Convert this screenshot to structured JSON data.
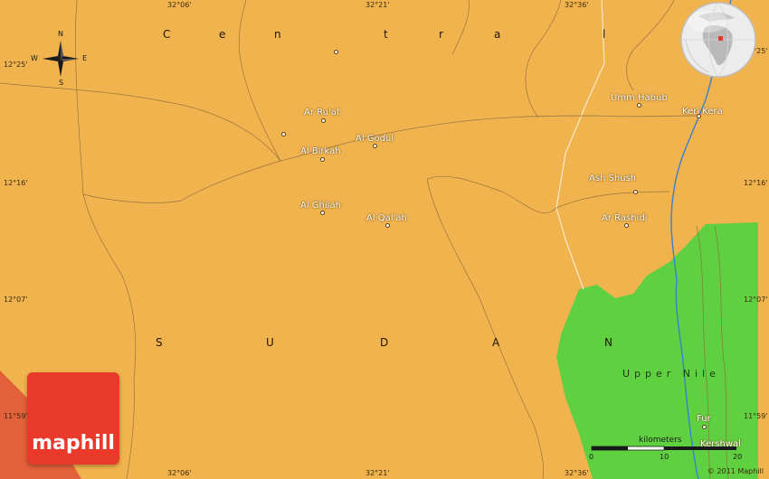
{
  "map": {
    "regions": {
      "central": [
        "C",
        "e",
        "n",
        "t",
        "r",
        "a",
        "l"
      ],
      "sudan": [
        "S",
        "U",
        "D",
        "A",
        "N"
      ],
      "upper_nile": "Upper Nile"
    },
    "places": [
      {
        "name": "Ar Ru'at",
        "id": "ar-ruat"
      },
      {
        "name": "Al Godul",
        "id": "al-godul"
      },
      {
        "name": "Al Birkah",
        "id": "al-birkah"
      },
      {
        "name": "Al Ghilah",
        "id": "al-ghilah"
      },
      {
        "name": "Al Qal'ah",
        "id": "al-qalah"
      },
      {
        "name": "Umm Habub",
        "id": "umm-habub"
      },
      {
        "name": "Keri Kera",
        "id": "keri-kera"
      },
      {
        "name": "Ash Shush",
        "id": "ash-shush"
      },
      {
        "name": "Ar Rashidi",
        "id": "ar-rashidi"
      },
      {
        "name": "Fur",
        "id": "fur"
      },
      {
        "name": "Kershwal",
        "id": "kershwal"
      }
    ],
    "coords": {
      "top": [
        "32°06'",
        "32°21'",
        "32°36'"
      ],
      "bottom": [
        "32°06'",
        "32°21'",
        "32°36'"
      ],
      "left": [
        "12°25'",
        "12°16'",
        "12°07'",
        "11°59'"
      ],
      "right": [
        "12°25'",
        "12°16'",
        "12°07'",
        "11°59'"
      ]
    },
    "compass": {
      "n": "N",
      "s": "S",
      "e": "E",
      "w": "W"
    },
    "scale": {
      "title": "kilometers",
      "ticks": [
        "0",
        "10",
        "20"
      ]
    },
    "logo": "maphill",
    "copyright": "© 2011 Maphill",
    "colors": {
      "land": "#f0b04a",
      "upper_nile": "#5fd040",
      "neighbor": "#e2603a",
      "river": "#3a7fd0",
      "logo": "#e8392b"
    }
  }
}
